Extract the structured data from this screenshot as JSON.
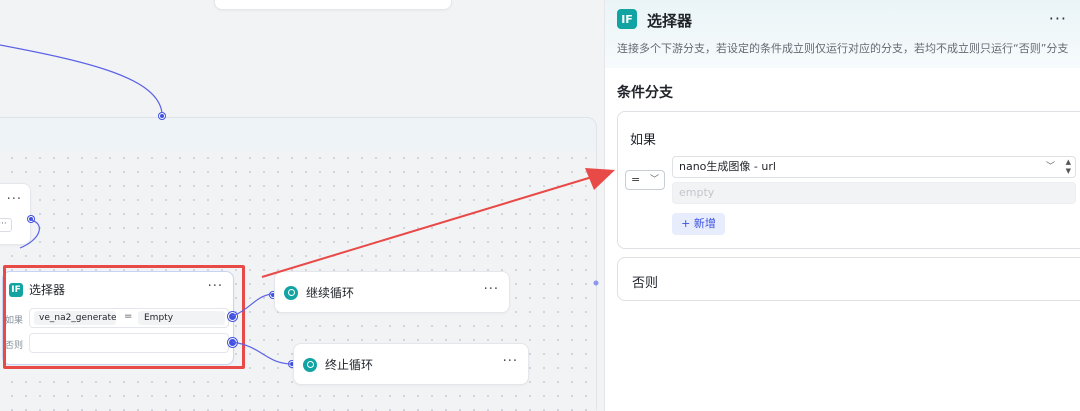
{
  "canvas": {
    "selector_node": {
      "title": "选择器",
      "more": "···",
      "if_label": "如果",
      "else_label": "否则",
      "condition": {
        "variable": "ve_na2_generate···",
        "operator": "=",
        "value": "Empty"
      }
    },
    "partial_node": {
      "more": "···",
      "mini": "···"
    },
    "continue_node": {
      "title": "继续循环",
      "more": "···"
    },
    "stop_node": {
      "title": "终止循环",
      "more": "···"
    }
  },
  "panel": {
    "icon_text": "IF",
    "title": "选择器",
    "more": "···",
    "description": "连接多个下游分支，若设定的条件成立则仅运行对应的分支，若均不成立则只运行“否则”分支",
    "section_title": "条件分支",
    "if_card": {
      "label": "如果",
      "operator": "=",
      "variable": "nano生成图像 - url",
      "value_placeholder": "empty",
      "add_button": "+ 新增"
    },
    "else_card": {
      "label": "否则"
    }
  },
  "colors": {
    "accent": "#4152e0",
    "teal": "#12a3a3",
    "highlight_red": "#e84a48"
  }
}
